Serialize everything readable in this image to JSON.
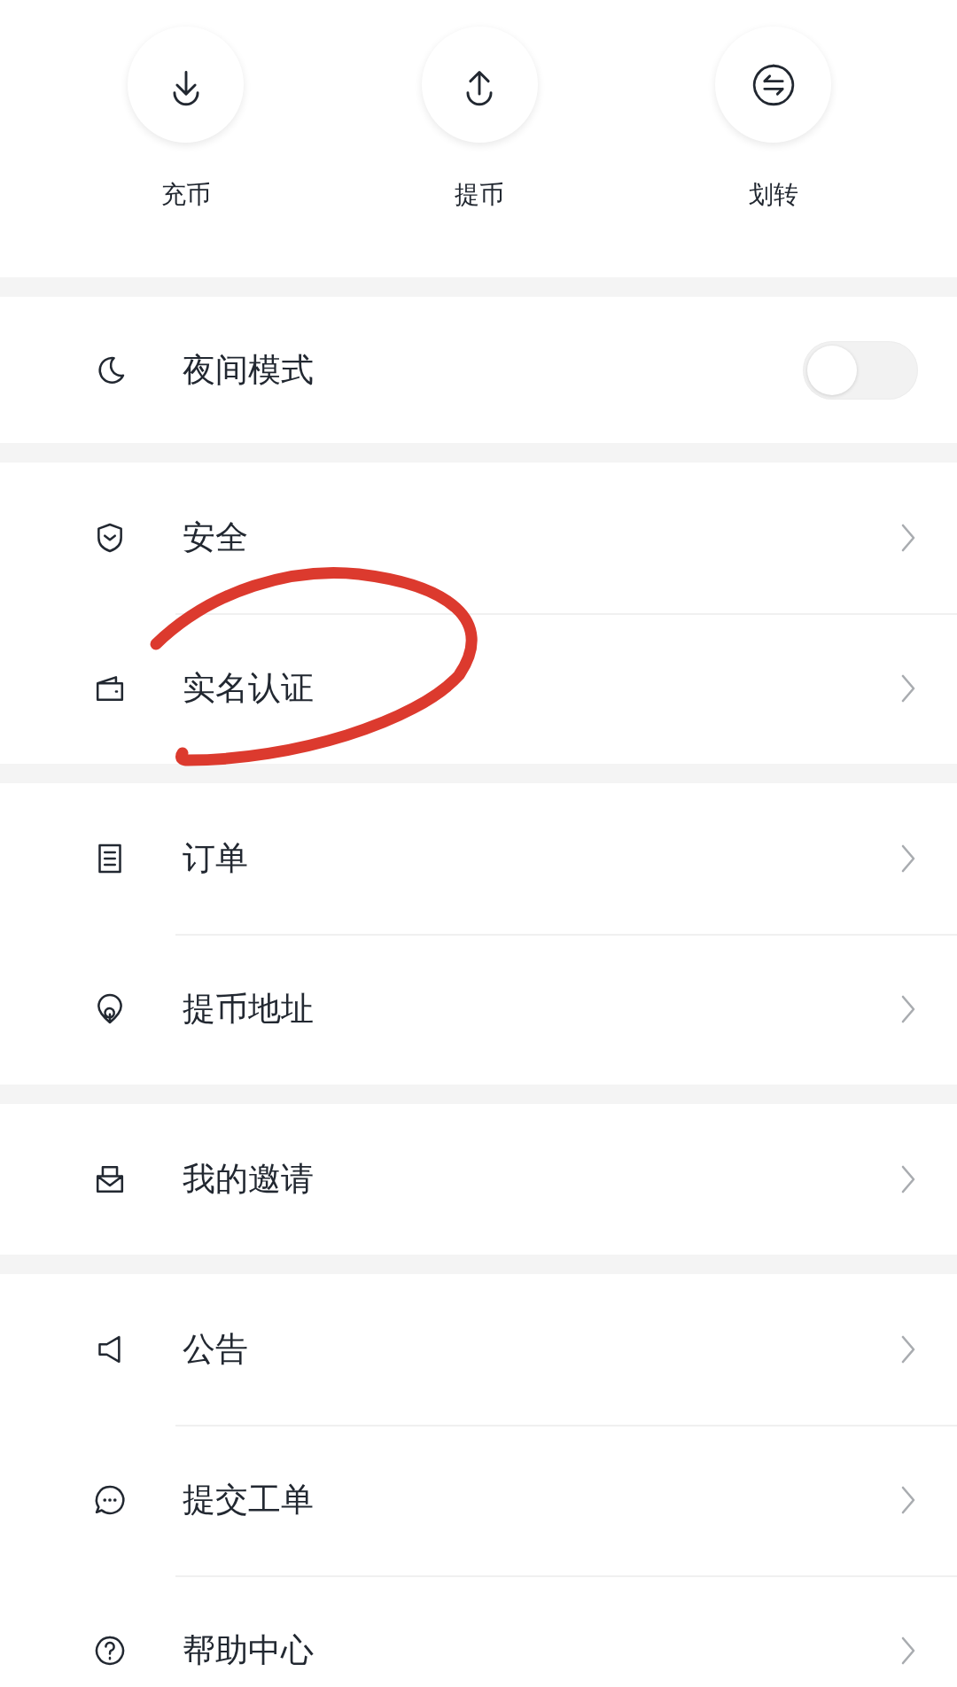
{
  "actions": [
    {
      "kind": "deposit",
      "label": "充币"
    },
    {
      "kind": "withdraw",
      "label": "提币"
    },
    {
      "kind": "transfer",
      "label": "划转"
    }
  ],
  "groups": [
    {
      "items": [
        {
          "kind": "toggle",
          "label": "夜间模式",
          "on": false
        }
      ]
    },
    {
      "items": [
        {
          "kind": "link",
          "label": "安全"
        },
        {
          "kind": "link",
          "label": "实名认证"
        }
      ]
    },
    {
      "items": [
        {
          "kind": "link",
          "label": "订单"
        },
        {
          "kind": "link",
          "label": "提币地址"
        }
      ]
    },
    {
      "items": [
        {
          "kind": "link",
          "label": "我的邀请"
        }
      ]
    },
    {
      "items": [
        {
          "kind": "link",
          "label": "公告"
        },
        {
          "kind": "link",
          "label": "提交工单"
        },
        {
          "kind": "link",
          "label": "帮助中心"
        }
      ]
    }
  ]
}
